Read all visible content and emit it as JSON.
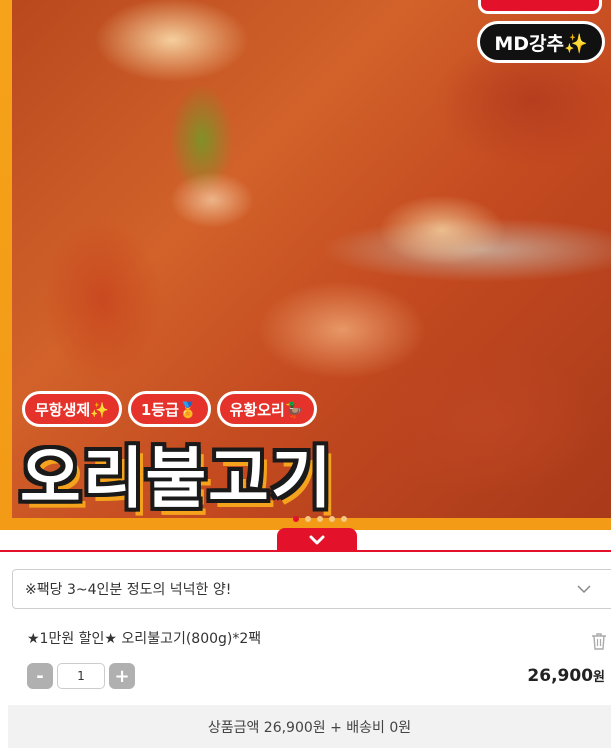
{
  "hero": {
    "md_badge": "MD강추✨",
    "tags": [
      "무항생제✨",
      "1등급🏅",
      "유황오리🦆"
    ],
    "title": "오리불고기",
    "slide_count": 5,
    "active_slide": 0
  },
  "option_select": {
    "value": "※팩당 3~4인분 정도의 넉넉한 양!"
  },
  "cart_item": {
    "name": "★1만원 할인★ 오리불고기(800g)*2팩",
    "quantity": "1",
    "minus_label": "-",
    "plus_label": "+",
    "price": "26,900",
    "price_unit": "원"
  },
  "summary": {
    "text": "상품금액 26,900원 + 배송비 0원"
  },
  "colors": {
    "accent_red": "#e3122a",
    "frame_orange": "#f39a16"
  }
}
